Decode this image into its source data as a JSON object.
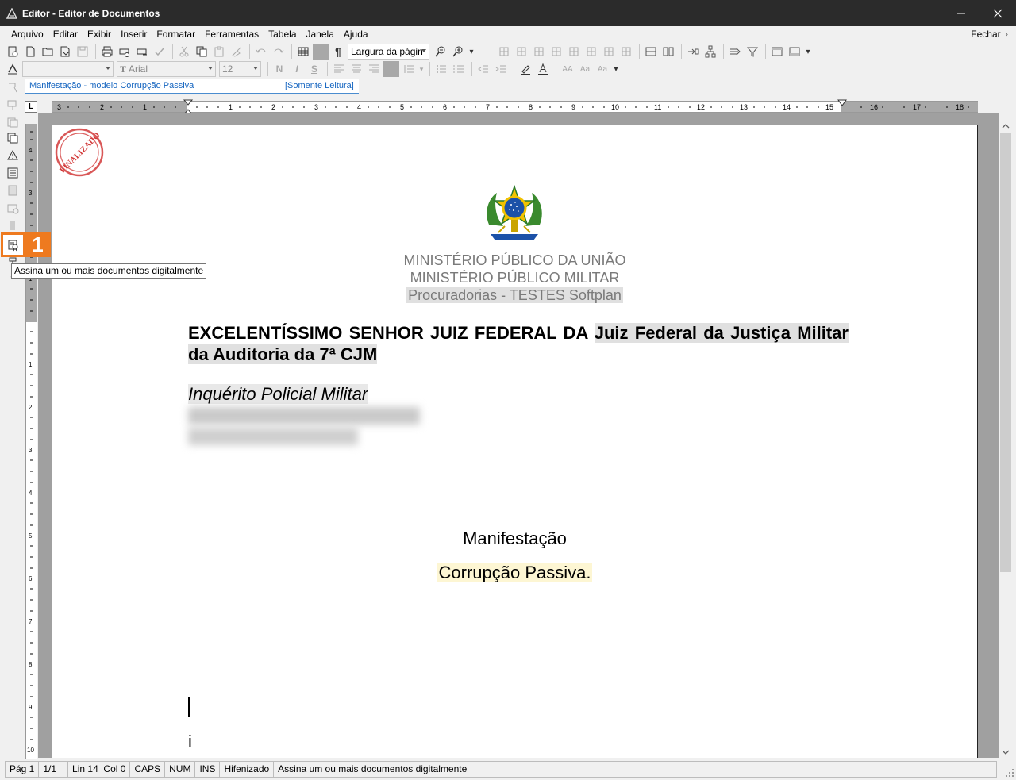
{
  "window": {
    "title": "Editor - Editor de Documentos",
    "app_icon": "editor-app-icon",
    "minimize_icon": "minimize-icon",
    "close_icon": "close-icon"
  },
  "menu": {
    "items": [
      "Arquivo",
      "Editar",
      "Exibir",
      "Inserir",
      "Formatar",
      "Ferramentas",
      "Tabela",
      "Janela",
      "Ajuda"
    ],
    "close_label": "Fechar",
    "chevron": "›"
  },
  "toolbar": {
    "zoom_value": "Largura da págin",
    "font_name": "Arial",
    "font_size": "12",
    "style_value": "",
    "pilcrow": "¶",
    "bold": "N",
    "italic": "I",
    "underline": "S"
  },
  "document_tab": {
    "label": "Manifestação - modelo Corrupção Passiva",
    "status": "[Somente Leitura]"
  },
  "ruler": {
    "tab_marker": "L"
  },
  "document": {
    "stamp_text": "FINALIZADO",
    "institution_lines": [
      "MINISTÉRIO PÚBLICO DA UNIÃO",
      "MINISTÉRIO PÚBLICO MILITAR",
      "Procuradorias - TESTES Softplan"
    ],
    "addressee_fixed": "EXCELENTÍSSIMO SENHOR JUIZ FEDERAL DA",
    "addressee_field": "Juiz Federal da Justiça Militar da Auditoria da 7ª CJM",
    "subtitle": "Inquérito Policial Militar",
    "heading": "Manifestação",
    "crime": "Corrupção Passiva.",
    "trailing_char": "i"
  },
  "annotation": {
    "badge": "1",
    "tooltip": "Assina um ou mais documentos digitalmente"
  },
  "statusbar": {
    "page": "Pág 1",
    "pages": "1/1",
    "position": "Lin 14  Col 0",
    "caps": "CAPS",
    "num": "NUM",
    "ins": "INS",
    "hyphen": "Hifenizado",
    "message": "Assina um ou mais documentos digitalmente"
  },
  "colors": {
    "titlebar": "#2b2b2b",
    "accent_orange": "#ee7a1f",
    "tab_text": "#1565c0",
    "stamp_red": "#d23a3a"
  }
}
